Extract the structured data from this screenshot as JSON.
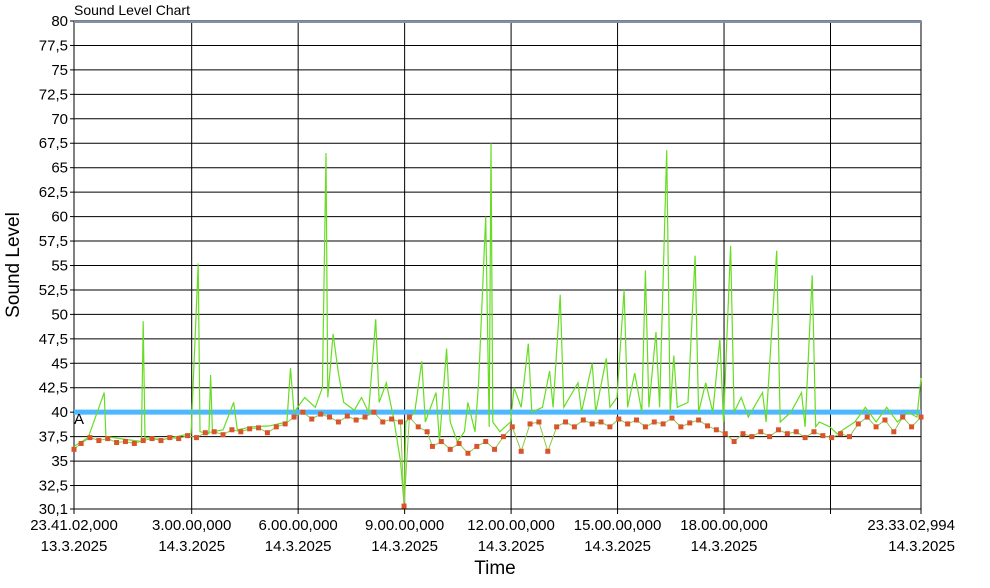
{
  "chart_data": {
    "type": "line",
    "title": "Sound Level Chart",
    "xlabel": "Time",
    "ylabel": "Sound Level",
    "ylim": [
      30.1,
      80
    ],
    "y_ticks": [
      "80",
      "77,5",
      "75",
      "72,5",
      "70",
      "67,5",
      "65",
      "62,5",
      "60",
      "57,5",
      "55",
      "52,5",
      "50",
      "47,5",
      "45",
      "42,5",
      "40",
      "37,5",
      "35",
      "32,5",
      "30,1"
    ],
    "x_ticks": [
      {
        "hours": 0,
        "time": "23.41.02,000",
        "date": "13.3.2025"
      },
      {
        "hours": 3.316,
        "time": "3.00.00,000",
        "date": "14.3.2025"
      },
      {
        "hours": 6.316,
        "time": "6.00.00,000",
        "date": "14.3.2025"
      },
      {
        "hours": 9.316,
        "time": "9.00.00,000",
        "date": "14.3.2025"
      },
      {
        "hours": 12.316,
        "time": "12.00.00,000",
        "date": "14.3.2025"
      },
      {
        "hours": 15.316,
        "time": "15.00.00,000",
        "date": "14.3.2025"
      },
      {
        "hours": 18.316,
        "time": "18.00.00,000",
        "date": "14.3.2025"
      },
      {
        "hours": 21.316,
        "time": "",
        "date": ""
      },
      {
        "hours": 23.866,
        "time": "23.33.02,994",
        "date": "14.3.2025"
      }
    ],
    "threshold": {
      "value": 40,
      "label": "A",
      "color": "#4db8ff"
    },
    "grid": true,
    "series": [
      {
        "style": "line",
        "color": "#66dd22",
        "points": [
          [
            0,
            36.5
          ],
          [
            0.4,
            37.4
          ],
          [
            0.85,
            42
          ],
          [
            0.9,
            37.5
          ],
          [
            1.5,
            37.2
          ],
          [
            1.9,
            37.0
          ],
          [
            1.95,
            49.3
          ],
          [
            2.0,
            37.4
          ],
          [
            2.5,
            37.2
          ],
          [
            3.0,
            37.6
          ],
          [
            3.3,
            37.8
          ],
          [
            3.5,
            55.2
          ],
          [
            3.55,
            38.0
          ],
          [
            3.8,
            37.8
          ],
          [
            3.85,
            43.8
          ],
          [
            3.9,
            38.0
          ],
          [
            4.2,
            38.2
          ],
          [
            4.5,
            41.0
          ],
          [
            4.6,
            38.2
          ],
          [
            5.0,
            38.5
          ],
          [
            5.5,
            38.6
          ],
          [
            6.0,
            39.0
          ],
          [
            6.1,
            44.5
          ],
          [
            6.2,
            40.0
          ],
          [
            6.5,
            41.5
          ],
          [
            6.8,
            40.5
          ],
          [
            7.0,
            42.5
          ],
          [
            7.1,
            66.5
          ],
          [
            7.15,
            41.5
          ],
          [
            7.3,
            48.0
          ],
          [
            7.45,
            44.0
          ],
          [
            7.6,
            41.0
          ],
          [
            7.9,
            40.2
          ],
          [
            8.1,
            41.5
          ],
          [
            8.3,
            40.0
          ],
          [
            8.5,
            49.5
          ],
          [
            8.6,
            41.0
          ],
          [
            8.8,
            43.0
          ],
          [
            9.0,
            39.5
          ],
          [
            9.2,
            35.0
          ],
          [
            9.3,
            30.5
          ],
          [
            9.35,
            39.0
          ],
          [
            9.6,
            40.0
          ],
          [
            9.8,
            45.2
          ],
          [
            9.9,
            39.0
          ],
          [
            10.2,
            42.0
          ],
          [
            10.3,
            37.0
          ],
          [
            10.5,
            46.5
          ],
          [
            10.6,
            39.0
          ],
          [
            10.8,
            37.0
          ],
          [
            11.0,
            38.0
          ],
          [
            11.1,
            41.0
          ],
          [
            11.3,
            38.0
          ],
          [
            11.4,
            43.0
          ],
          [
            11.6,
            60.0
          ],
          [
            11.7,
            38.5
          ],
          [
            11.75,
            67.5
          ],
          [
            11.8,
            39.0
          ],
          [
            12.0,
            38.0
          ],
          [
            12.3,
            39.0
          ],
          [
            12.4,
            42.5
          ],
          [
            12.6,
            40.5
          ],
          [
            12.8,
            47.0
          ],
          [
            12.9,
            40.0
          ],
          [
            13.2,
            40.5
          ],
          [
            13.4,
            44.2
          ],
          [
            13.5,
            40.5
          ],
          [
            13.7,
            52.0
          ],
          [
            13.8,
            40.5
          ],
          [
            14.2,
            43.0
          ],
          [
            14.3,
            40.0
          ],
          [
            14.6,
            45.0
          ],
          [
            14.7,
            40.0
          ],
          [
            15.0,
            45.5
          ],
          [
            15.1,
            40.5
          ],
          [
            15.3,
            41.5
          ],
          [
            15.5,
            52.5
          ],
          [
            15.6,
            40.5
          ],
          [
            15.8,
            44.0
          ],
          [
            16.0,
            40.0
          ],
          [
            16.1,
            54.5
          ],
          [
            16.2,
            40.5
          ],
          [
            16.4,
            48.2
          ],
          [
            16.5,
            40.5
          ],
          [
            16.7,
            66.8
          ],
          [
            16.8,
            40.0
          ],
          [
            16.9,
            45.8
          ],
          [
            17.0,
            40.5
          ],
          [
            17.3,
            41.0
          ],
          [
            17.5,
            56.0
          ],
          [
            17.6,
            40.0
          ],
          [
            17.8,
            43.0
          ],
          [
            18.0,
            40.0
          ],
          [
            18.2,
            47.5
          ],
          [
            18.3,
            39.0
          ],
          [
            18.5,
            57.0
          ],
          [
            18.6,
            40.0
          ],
          [
            18.8,
            41.5
          ],
          [
            19.0,
            39.5
          ],
          [
            19.4,
            42.0
          ],
          [
            19.5,
            39.0
          ],
          [
            19.8,
            56.5
          ],
          [
            19.9,
            39.0
          ],
          [
            20.2,
            40.0
          ],
          [
            20.5,
            42.0
          ],
          [
            20.6,
            38.5
          ],
          [
            20.8,
            54.0
          ],
          [
            20.9,
            38.5
          ],
          [
            21.0,
            39.0
          ],
          [
            21.3,
            38.5
          ],
          [
            21.5,
            37.8
          ],
          [
            22.0,
            39.0
          ],
          [
            22.3,
            40.5
          ],
          [
            22.6,
            39.0
          ],
          [
            22.9,
            40.5
          ],
          [
            23.2,
            39.0
          ],
          [
            23.5,
            40.0
          ],
          [
            23.75,
            39.5
          ],
          [
            23.866,
            43.5
          ]
        ]
      },
      {
        "style": "markers",
        "color": "#d9542b",
        "points": [
          [
            0,
            36.2
          ],
          [
            0.2,
            36.8
          ],
          [
            0.45,
            37.4
          ],
          [
            0.7,
            37.1
          ],
          [
            0.95,
            37.3
          ],
          [
            1.2,
            36.9
          ],
          [
            1.45,
            37.0
          ],
          [
            1.7,
            36.8
          ],
          [
            1.95,
            37.1
          ],
          [
            2.2,
            37.3
          ],
          [
            2.45,
            37.1
          ],
          [
            2.7,
            37.4
          ],
          [
            2.95,
            37.3
          ],
          [
            3.2,
            37.6
          ],
          [
            3.45,
            37.4
          ],
          [
            3.7,
            37.9
          ],
          [
            3.95,
            38.0
          ],
          [
            4.2,
            37.7
          ],
          [
            4.45,
            38.2
          ],
          [
            4.7,
            38.0
          ],
          [
            4.95,
            38.3
          ],
          [
            5.2,
            38.4
          ],
          [
            5.45,
            37.9
          ],
          [
            5.7,
            38.5
          ],
          [
            5.95,
            38.8
          ],
          [
            6.2,
            39.5
          ],
          [
            6.45,
            40.0
          ],
          [
            6.7,
            39.3
          ],
          [
            6.95,
            39.8
          ],
          [
            7.2,
            39.5
          ],
          [
            7.45,
            39.0
          ],
          [
            7.7,
            39.6
          ],
          [
            7.95,
            39.2
          ],
          [
            8.2,
            39.5
          ],
          [
            8.45,
            40.0
          ],
          [
            8.7,
            39.0
          ],
          [
            8.95,
            39.3
          ],
          [
            9.2,
            39.0
          ],
          [
            9.3,
            30.4
          ],
          [
            9.45,
            39.5
          ],
          [
            9.7,
            38.5
          ],
          [
            9.95,
            38.0
          ],
          [
            10.1,
            36.5
          ],
          [
            10.35,
            37.0
          ],
          [
            10.6,
            36.2
          ],
          [
            10.85,
            36.8
          ],
          [
            11.1,
            35.8
          ],
          [
            11.35,
            36.5
          ],
          [
            11.6,
            37.0
          ],
          [
            11.85,
            36.2
          ],
          [
            12.1,
            37.5
          ],
          [
            12.35,
            38.5
          ],
          [
            12.6,
            36.0
          ],
          [
            12.85,
            38.8
          ],
          [
            13.1,
            39.0
          ],
          [
            13.35,
            36.0
          ],
          [
            13.6,
            38.5
          ],
          [
            13.85,
            39.0
          ],
          [
            14.1,
            38.5
          ],
          [
            14.35,
            39.2
          ],
          [
            14.6,
            38.8
          ],
          [
            14.85,
            39.0
          ],
          [
            15.1,
            38.5
          ],
          [
            15.35,
            39.3
          ],
          [
            15.6,
            38.8
          ],
          [
            15.85,
            39.2
          ],
          [
            16.1,
            38.5
          ],
          [
            16.35,
            39.0
          ],
          [
            16.6,
            38.8
          ],
          [
            16.85,
            39.4
          ],
          [
            17.1,
            38.5
          ],
          [
            17.35,
            38.9
          ],
          [
            17.6,
            39.2
          ],
          [
            17.85,
            38.6
          ],
          [
            18.1,
            38.2
          ],
          [
            18.35,
            37.8
          ],
          [
            18.6,
            37.0
          ],
          [
            18.85,
            37.8
          ],
          [
            19.1,
            37.5
          ],
          [
            19.35,
            38.0
          ],
          [
            19.6,
            37.5
          ],
          [
            19.85,
            38.2
          ],
          [
            20.1,
            37.8
          ],
          [
            20.35,
            38.0
          ],
          [
            20.6,
            37.4
          ],
          [
            20.85,
            38.0
          ],
          [
            21.1,
            37.6
          ],
          [
            21.35,
            37.4
          ],
          [
            21.6,
            37.8
          ],
          [
            21.85,
            37.5
          ],
          [
            22.1,
            38.8
          ],
          [
            22.35,
            39.5
          ],
          [
            22.6,
            38.5
          ],
          [
            22.85,
            39.2
          ],
          [
            23.1,
            38.0
          ],
          [
            23.35,
            39.5
          ],
          [
            23.6,
            38.5
          ],
          [
            23.866,
            39.5
          ]
        ]
      }
    ]
  }
}
